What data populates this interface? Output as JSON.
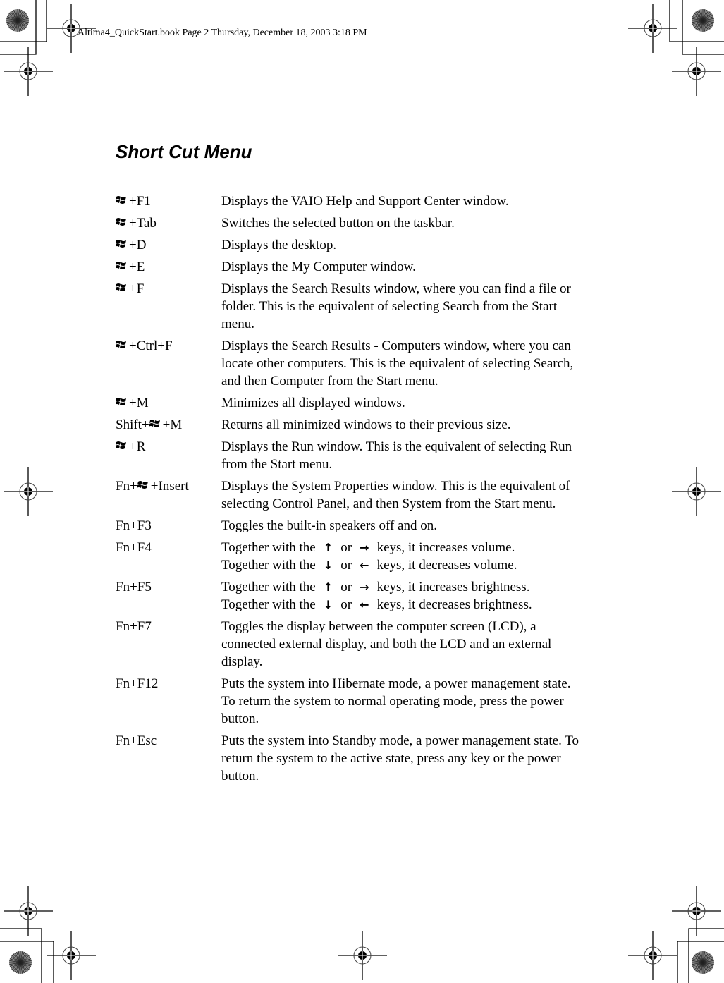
{
  "slug": "Altima4_QuickStart.book  Page 2  Thursday, December 18, 2003  3:18 PM",
  "title": "Short Cut Menu",
  "shortcuts": [
    {
      "prefix": "",
      "win": true,
      "suffix": "+F1",
      "desc": [
        "Displays the VAIO Help and Support Center window."
      ]
    },
    {
      "prefix": "",
      "win": true,
      "suffix": "+Tab",
      "desc": [
        "Switches the selected button on the taskbar."
      ]
    },
    {
      "prefix": "",
      "win": true,
      "suffix": "+D",
      "desc": [
        "Displays the desktop."
      ]
    },
    {
      "prefix": "",
      "win": true,
      "suffix": "+E",
      "desc": [
        "Displays the My Computer window."
      ]
    },
    {
      "prefix": "",
      "win": true,
      "suffix": "+F",
      "desc": [
        "Displays the Search Results window, where you can find a file or folder. This is the equivalent of selecting Search from the Start menu."
      ]
    },
    {
      "prefix": "",
      "win": true,
      "suffix": "+Ctrl+F",
      "desc": [
        "Displays the Search Results - Computers window, where you can locate other computers. This is the equivalent of selecting Search, and then Computer from the Start menu."
      ]
    },
    {
      "prefix": "",
      "win": true,
      "suffix": "+M",
      "desc": [
        "Minimizes all displayed windows."
      ]
    },
    {
      "prefix": "Shift+",
      "win": true,
      "suffix": "+M",
      "desc": [
        "Returns all minimized windows to their previous size."
      ]
    },
    {
      "prefix": "",
      "win": true,
      "suffix": "+R",
      "desc": [
        "Displays the Run window. This is the equivalent of selecting Run from the Start menu."
      ]
    },
    {
      "prefix": "Fn+",
      "win": true,
      "suffix": "+Insert",
      "desc": [
        "Displays the System Properties window. This is the equivalent of selecting Control Panel, and then System from the Start menu."
      ]
    },
    {
      "prefix": "Fn+F3",
      "win": false,
      "suffix": "",
      "desc": [
        "Toggles the built-in speakers off and on."
      ]
    },
    {
      "prefix": "Fn+F4",
      "win": false,
      "suffix": "",
      "arrows": [
        {
          "before": "Together with the",
          "a1": "↑",
          "or": "or",
          "a2": "→",
          "after": "keys, it increases volume."
        },
        {
          "before": "Together with the",
          "a1": "↓",
          "or": "or",
          "a2": "←",
          "after": "keys, it decreases volume."
        }
      ]
    },
    {
      "prefix": "Fn+F5",
      "win": false,
      "suffix": "",
      "arrows": [
        {
          "before": "Together with the",
          "a1": "↑",
          "or": "or",
          "a2": "→",
          "after": "keys, it increases brightness."
        },
        {
          "before": "Together with the",
          "a1": "↓",
          "or": "or",
          "a2": "←",
          "after": "keys, it decreases brightness."
        }
      ]
    },
    {
      "prefix": "Fn+F7",
      "win": false,
      "suffix": "",
      "desc": [
        "Toggles the display between the computer screen (LCD), a connected external display, and both the LCD and an external display."
      ]
    },
    {
      "prefix": "Fn+F12",
      "win": false,
      "suffix": "",
      "desc": [
        "Puts the system into Hibernate mode, a power management state. To return the system to normal operating mode, press the power button."
      ]
    },
    {
      "prefix": "Fn+Esc",
      "win": false,
      "suffix": "",
      "desc": [
        "Puts the system into Standby mode, a power management state. To return the system to the active state, press any key or the power button."
      ]
    }
  ]
}
